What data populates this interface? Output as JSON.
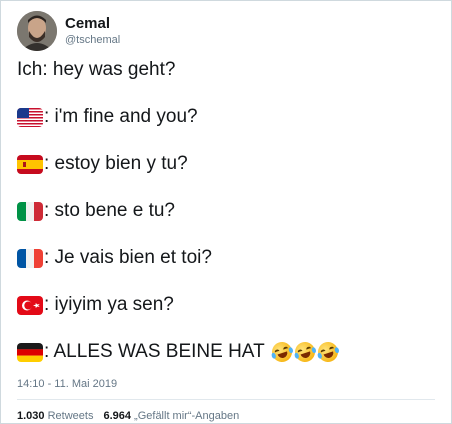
{
  "author": {
    "display_name": "Cemal",
    "handle": "@tschemal"
  },
  "tweet": {
    "lines": [
      {
        "flag": null,
        "text": "Ich: hey was geht?"
      },
      {
        "flag": "us-flag",
        "text": ": i'm fine and you?"
      },
      {
        "flag": "spain-flag",
        "text": ": estoy bien y tu?"
      },
      {
        "flag": "italy-flag",
        "text": ": sto bene e tu?"
      },
      {
        "flag": "france-flag",
        "text": ": Je vais bien et toi?"
      },
      {
        "flag": "turkey-flag",
        "text": ": iyiyim ya sen?"
      },
      {
        "flag": "germany-flag",
        "text": ": ALLES WAS BEINE HAT",
        "emojis": [
          "rolling-on-floor-laughing-icon",
          "rolling-on-floor-laughing-icon",
          "rolling-on-floor-laughing-icon"
        ]
      }
    ],
    "timestamp": "14:10 - 11. Mai 2019"
  },
  "stats": {
    "retweets_count": "1.030",
    "retweets_label": "Retweets",
    "likes_count": "6.964",
    "likes_label": "„Gefällt mir“-Angaben"
  },
  "colors": {
    "text": "#14171a",
    "secondary": "#657786",
    "border": "#cfd9de"
  }
}
